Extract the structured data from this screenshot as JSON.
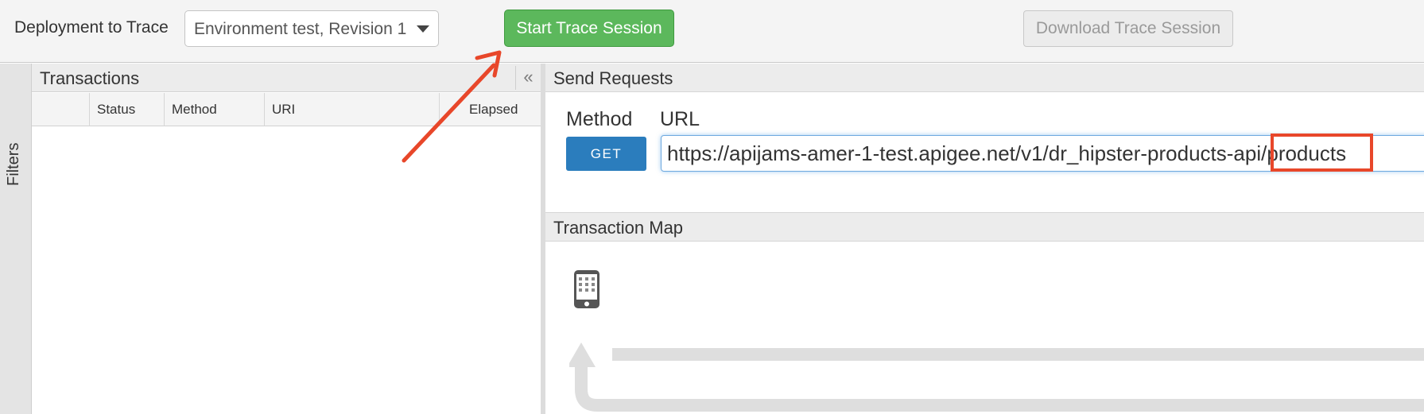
{
  "toolbar": {
    "deployment_label": "Deployment to Trace",
    "deployment_select_value": "Environment test, Revision 1",
    "start_button_label": "Start Trace Session",
    "download_button_label": "Download Trace Session"
  },
  "filters": {
    "label": "Filters"
  },
  "transactions": {
    "title": "Transactions",
    "collapse_icon": "double-chevron-left-icon",
    "columns": [
      "",
      "Status",
      "Method",
      "URI",
      "Elapsed"
    ],
    "rows": []
  },
  "send_requests": {
    "title": "Send Requests",
    "method_label": "Method",
    "url_label": "URL",
    "method_value": "GET",
    "url_value": "https://apijams-amer-1-test.apigee.net/v1/dr_hipster-products-api/products"
  },
  "transaction_map": {
    "title": "Transaction Map",
    "client_icon": "mobile-phone-icon"
  },
  "colors": {
    "start_button": "#5cb85c",
    "get_button": "#2b7dbd",
    "annotation": "#e8472a"
  }
}
